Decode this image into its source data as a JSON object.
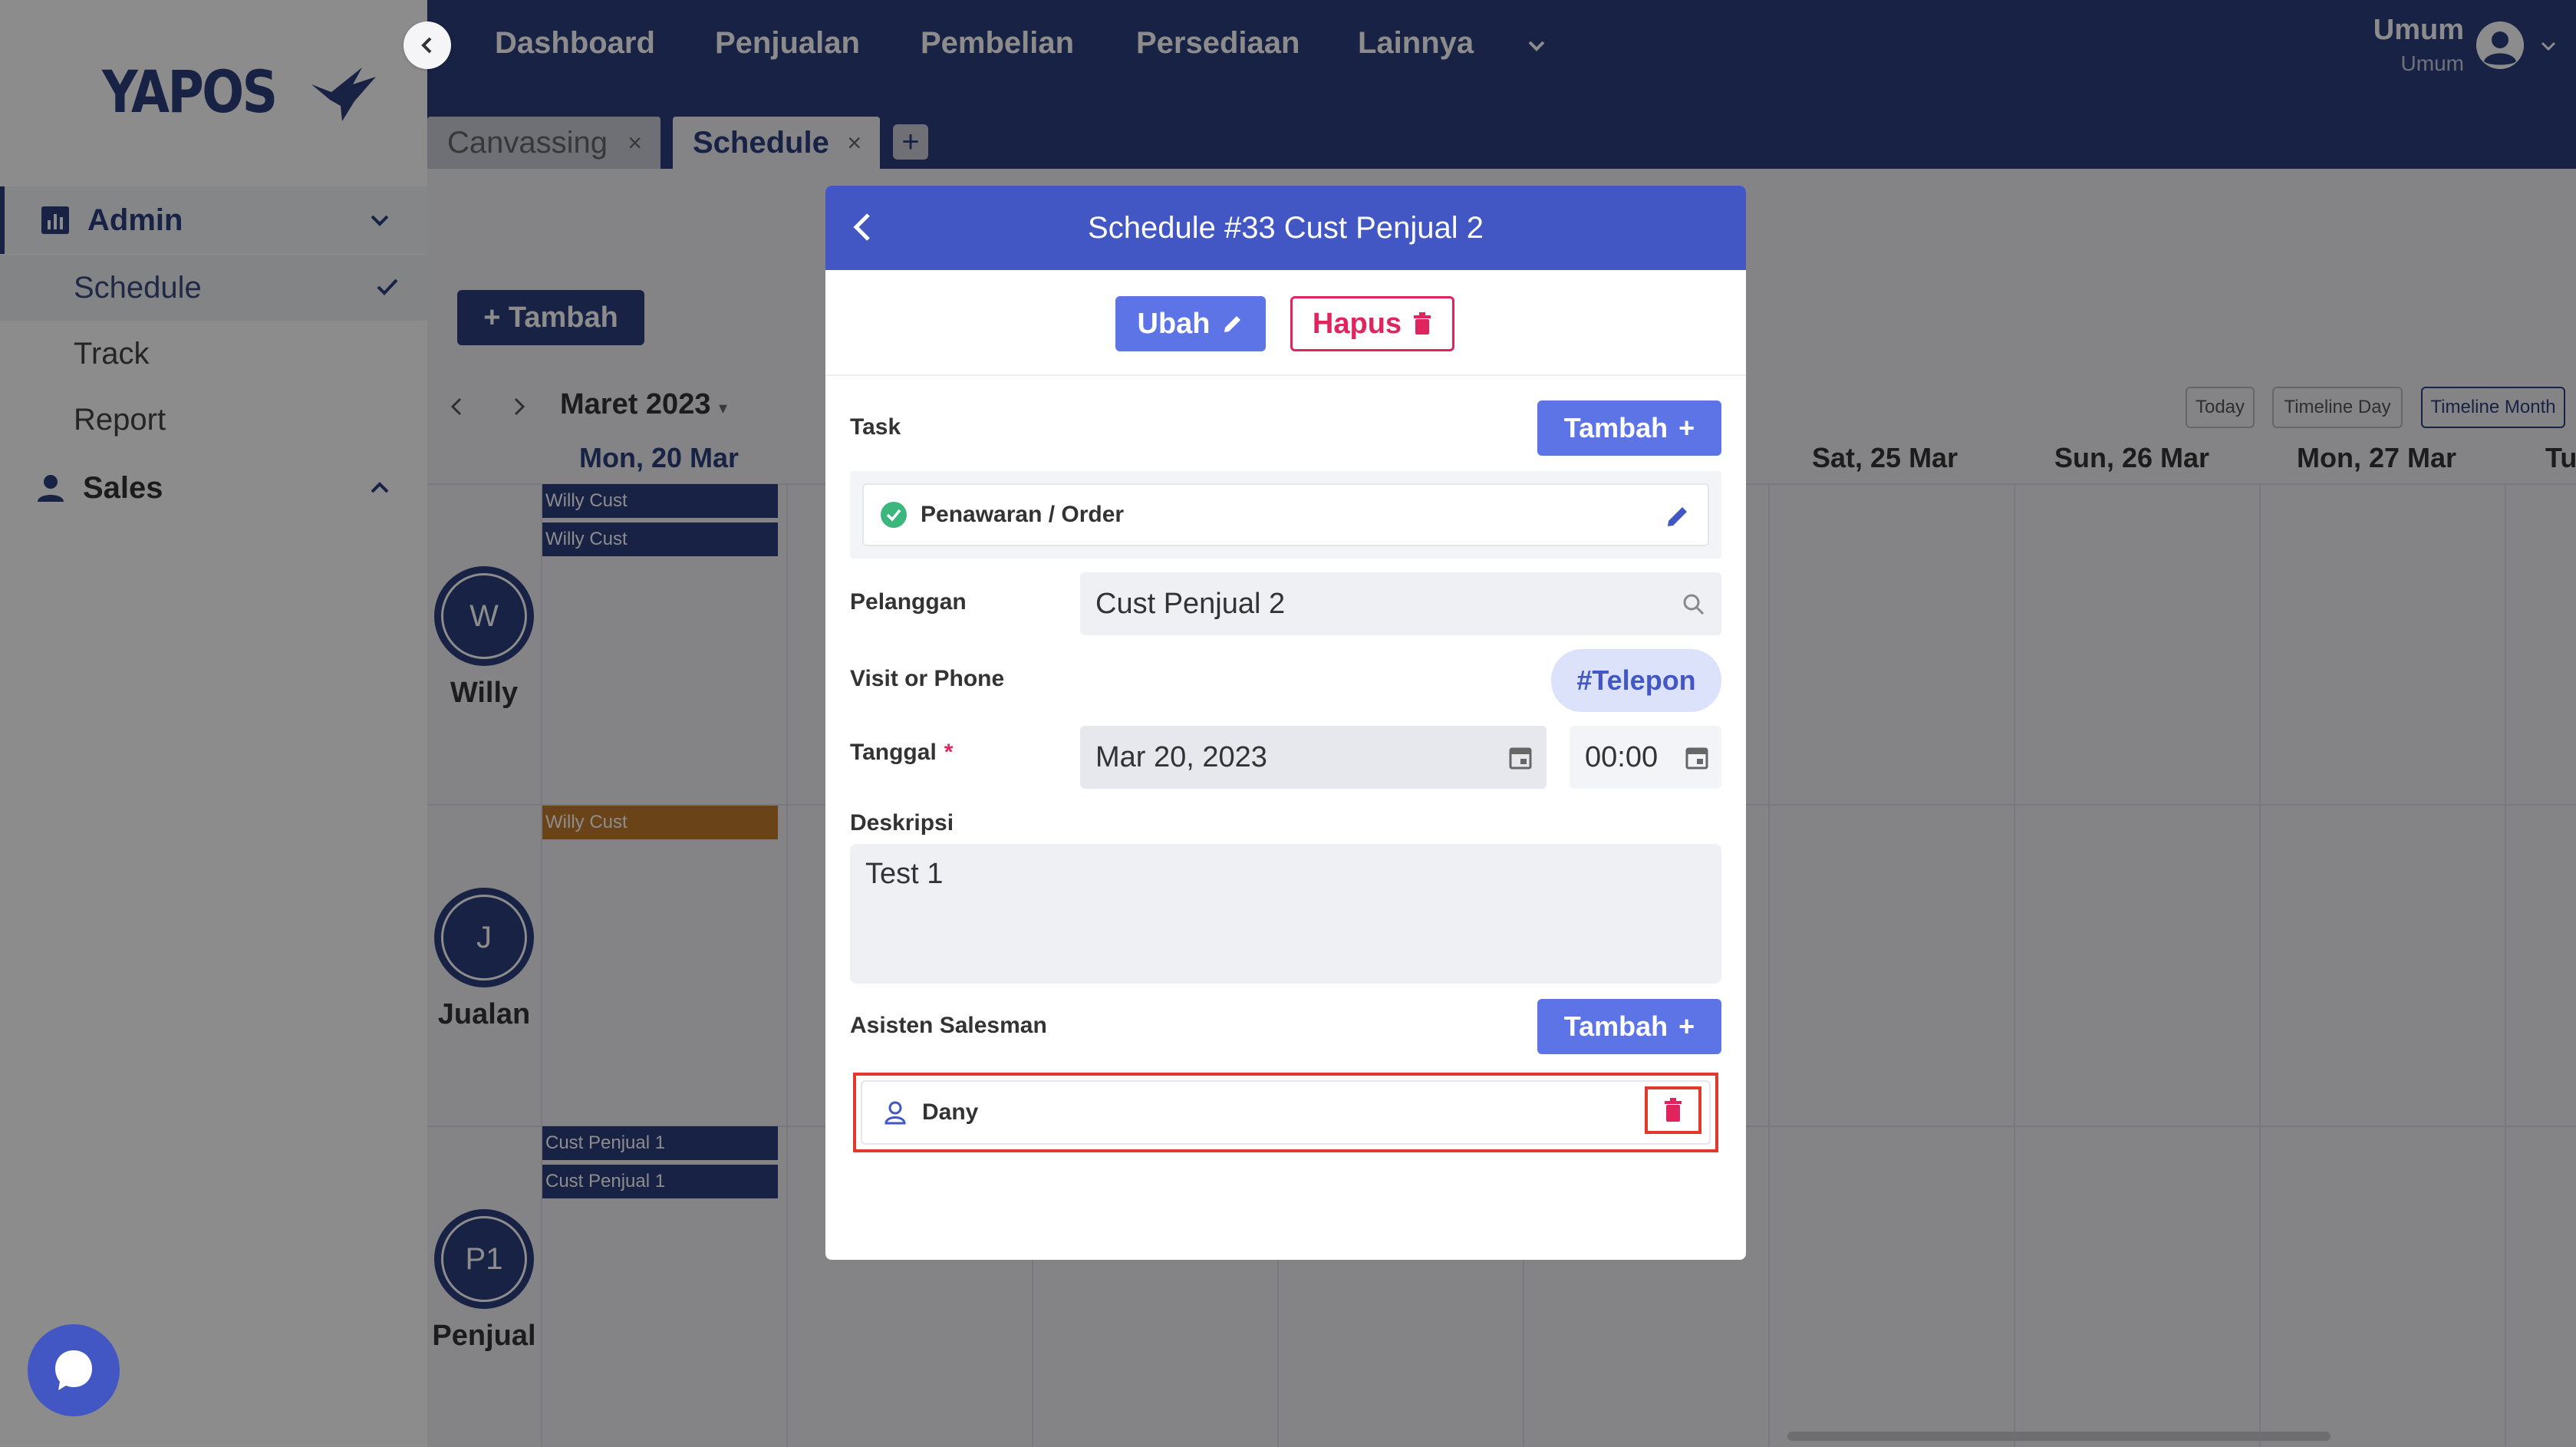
{
  "brand": {
    "name": "YAPOS"
  },
  "sidebar": {
    "groups": [
      {
        "label": "Admin",
        "items": [
          "Schedule",
          "Track",
          "Report"
        ]
      },
      {
        "label": "Sales"
      }
    ]
  },
  "nav": {
    "items": [
      "Dashboard",
      "Penjualan",
      "Pembelian",
      "Persediaan",
      "Lainnya"
    ],
    "user": {
      "name": "Umum",
      "role": "Umum"
    }
  },
  "tabs": [
    {
      "label": "Canvassing",
      "close": "×"
    },
    {
      "label": "Schedule",
      "close": "×"
    }
  ],
  "tab_add": "+",
  "calendar": {
    "add_button": "+ Tambah",
    "month": "Maret 2023",
    "views": [
      "Today",
      "Timeline Day",
      "Timeline Month"
    ],
    "days": [
      "Mon, 20 Mar",
      "Sat, 25 Mar",
      "Sun, 26 Mar",
      "Mon, 27 Mar",
      "Tu"
    ],
    "resources": [
      {
        "initial": "W",
        "name": "Willy"
      },
      {
        "initial": "J",
        "name": "Jualan"
      },
      {
        "initial": "P1",
        "name": "Penjual"
      }
    ],
    "events": [
      "Willy Cust",
      "Willy Cust",
      "Willy Cust",
      "Cust Penjual 1",
      "Cust Penjual 1"
    ]
  },
  "modal": {
    "title": "Schedule #33 Cust Penjual 2",
    "ubah": "Ubah",
    "hapus": "Hapus",
    "task_label": "Task",
    "tambah": "Tambah",
    "task_item": "Penawaran / Order",
    "pelanggan_label": "Pelanggan",
    "pelanggan_value": "Cust Penjual 2",
    "visit_label": "Visit or Phone",
    "visit_tag": "#Telepon",
    "tanggal_label": "Tanggal",
    "tanggal_required": "*",
    "date_value": "Mar 20, 2023",
    "time_value": "00:00",
    "deskripsi_label": "Deskripsi",
    "deskripsi_value": "Test 1",
    "asisten_label": "Asisten Salesman",
    "asisten_item": "Dany"
  },
  "colors": {
    "primary_dark": "#2d3e7c",
    "modal_header": "#4257c4",
    "button_blue": "#5c74e6",
    "danger": "#e0245e",
    "success": "#3bb77e",
    "highlight": "#e03a2d",
    "event_orange": "#c47a2d"
  },
  "icons": [
    "bird-logo-icon",
    "chevron-left-icon",
    "chart-icon",
    "chevron-down-icon",
    "check-icon",
    "person-icon",
    "chevron-up-icon",
    "user-avatar-icon",
    "pencil-icon",
    "trash-icon",
    "check-circle-icon",
    "search-icon",
    "calendar-icon",
    "user-outline-icon",
    "chat-icon"
  ]
}
